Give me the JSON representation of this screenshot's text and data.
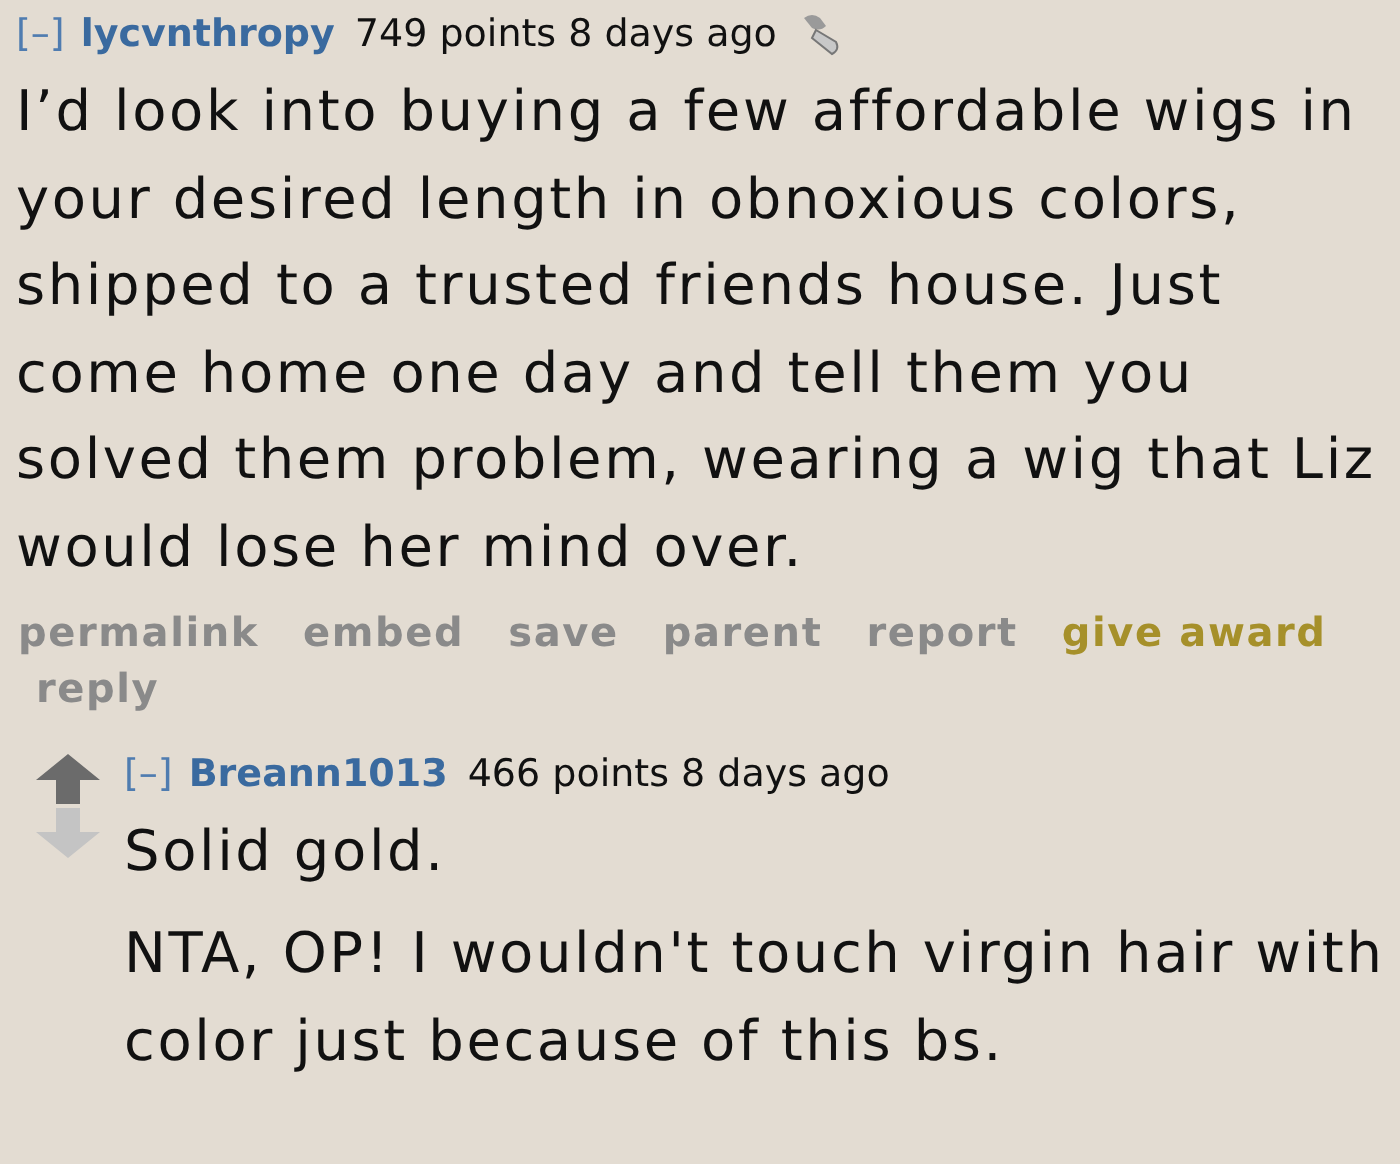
{
  "comments": [
    {
      "collapse": "[–]",
      "author": "lycvnthropy",
      "score": "749 points",
      "age": "8 days ago",
      "award": true,
      "body": [
        "I’d look into buying a few affordable wigs in your desired length in obnoxious colors, shipped to a trusted friends house. Just come home one day and tell them you solved them problem, wearing a wig that Liz would lose her mind over."
      ],
      "actions": [
        {
          "label": "permalink",
          "kind": "plain"
        },
        {
          "label": "embed",
          "kind": "plain"
        },
        {
          "label": "save",
          "kind": "plain"
        },
        {
          "label": "parent",
          "kind": "plain"
        },
        {
          "label": "report",
          "kind": "plain"
        },
        {
          "label": "give award",
          "kind": "award"
        },
        {
          "label": "reply",
          "kind": "plain"
        }
      ]
    },
    {
      "collapse": "[–]",
      "author": "Breann1013",
      "score": "466 points",
      "age": "8 days ago",
      "votes": true,
      "body": [
        "Solid gold.",
        "NTA, OP! I wouldn't touch virgin hair with color just because of this bs."
      ]
    }
  ]
}
